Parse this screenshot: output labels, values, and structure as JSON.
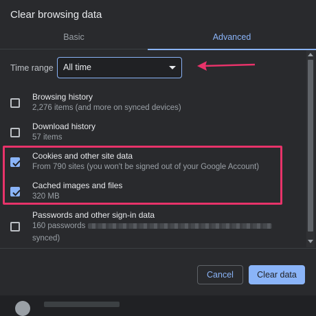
{
  "dialog": {
    "title": "Clear browsing data",
    "tabs": [
      {
        "label": "Basic",
        "active": false
      },
      {
        "label": "Advanced",
        "active": true
      }
    ]
  },
  "time_range": {
    "label": "Time range",
    "value": "All time"
  },
  "items": [
    {
      "title": "Browsing history",
      "subtitle": "2,276 items (and more on synced devices)",
      "checked": false
    },
    {
      "title": "Download history",
      "subtitle": "57 items",
      "checked": false
    },
    {
      "title": "Cookies and other site data",
      "subtitle": "From 790 sites (you won't be signed out of your Google Account)",
      "checked": true
    },
    {
      "title": "Cached images and files",
      "subtitle": "320 MB",
      "checked": true
    },
    {
      "title": "Passwords and other sign-in data",
      "subtitle": "160 passwords",
      "subtitle2": "synced)",
      "checked": false
    }
  ],
  "buttons": {
    "cancel": "Cancel",
    "clear": "Clear data"
  },
  "colors": {
    "accent": "#8ab4f8",
    "annotation": "#e8336a",
    "background": "#292a2d"
  }
}
